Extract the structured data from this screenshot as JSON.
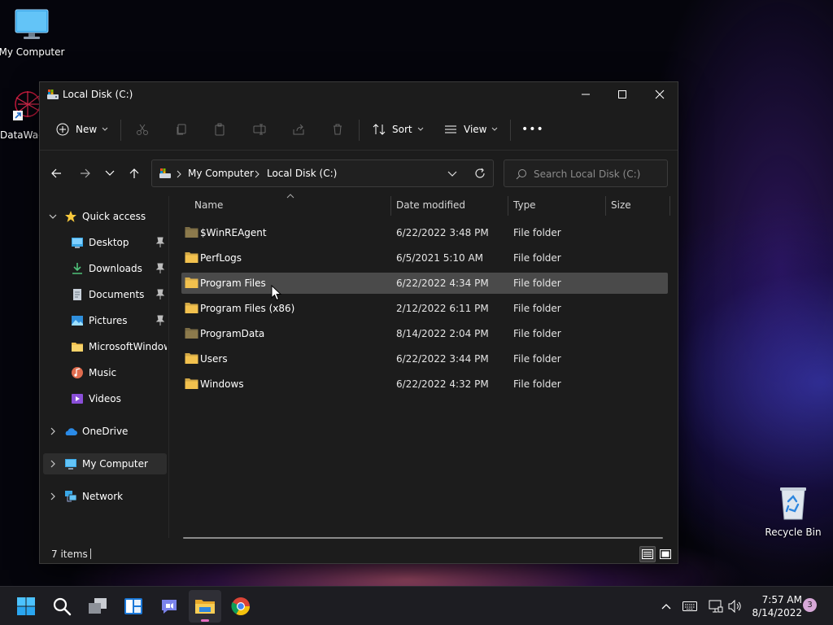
{
  "desktop": {
    "icons": [
      {
        "label": "My Computer",
        "icon": "monitor-icon"
      },
      {
        "label": "DataWag",
        "icon": "datawag-app-icon"
      },
      {
        "label": "Recycle Bin",
        "icon": "recycle-bin-icon"
      }
    ]
  },
  "window": {
    "title": "Local Disk (C:)",
    "controls": {
      "minimize": "minimize-icon",
      "maximize": "maximize-icon",
      "close": "close-icon"
    }
  },
  "toolbar": {
    "new_label": "New",
    "sort_label": "Sort",
    "view_label": "View",
    "more_label": "•••"
  },
  "address": {
    "crumbs": [
      "My Computer",
      "Local Disk (C:)"
    ],
    "search_placeholder": "Search Local Disk (C:)"
  },
  "navpane": {
    "quick_access": "Quick access",
    "items": [
      {
        "label": "Desktop",
        "pinned": true,
        "icon": "desktop-folder-icon"
      },
      {
        "label": "Downloads",
        "pinned": true,
        "icon": "downloads-icon"
      },
      {
        "label": "Documents",
        "pinned": true,
        "icon": "documents-icon"
      },
      {
        "label": "Pictures",
        "pinned": true,
        "icon": "pictures-icon"
      },
      {
        "label": "MicrosoftWindows",
        "pinned": false,
        "icon": "folder-icon"
      },
      {
        "label": "Music",
        "pinned": false,
        "icon": "music-icon"
      },
      {
        "label": "Videos",
        "pinned": false,
        "icon": "videos-icon"
      }
    ],
    "onedrive": "OneDrive",
    "my_computer": "My Computer",
    "network": "Network"
  },
  "filelist": {
    "columns": {
      "name": "Name",
      "date": "Date modified",
      "type": "Type",
      "size": "Size"
    },
    "rows": [
      {
        "name": "$WinREAgent",
        "date": "6/22/2022 3:48 PM",
        "type": "File folder",
        "hidden": true
      },
      {
        "name": "PerfLogs",
        "date": "6/5/2021 5:10 AM",
        "type": "File folder",
        "hidden": false
      },
      {
        "name": "Program Files",
        "date": "6/22/2022 4:34 PM",
        "type": "File folder",
        "hidden": false
      },
      {
        "name": "Program Files (x86)",
        "date": "2/12/2022 6:11 PM",
        "type": "File folder",
        "hidden": false
      },
      {
        "name": "ProgramData",
        "date": "8/14/2022 2:04 PM",
        "type": "File folder",
        "hidden": true
      },
      {
        "name": "Users",
        "date": "6/22/2022 3:44 PM",
        "type": "File folder",
        "hidden": false
      },
      {
        "name": "Windows",
        "date": "6/22/2022 4:32 PM",
        "type": "File folder",
        "hidden": false
      }
    ]
  },
  "status": {
    "items_count": "7 items"
  },
  "taskbar": {
    "time": "7:57 AM",
    "date": "8/14/2022",
    "notification_count": "3"
  },
  "colors": {
    "folder": "#f2c14e",
    "folder_hidden": "#8c7a4c",
    "accent_blue": "#4cc2ff",
    "hover_row": "#4a4a4a"
  }
}
